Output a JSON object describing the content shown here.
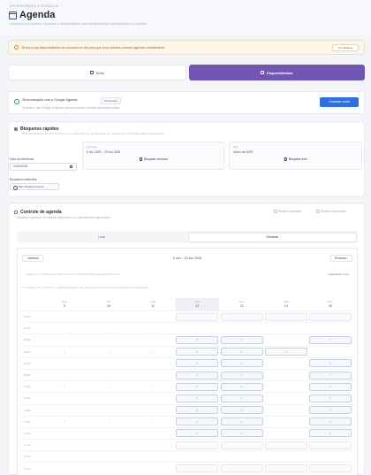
{
  "header": {
    "breadcrumb": "APPOINTMENTS & SCHEDULE",
    "title": "Agenda",
    "subtitle": "Gerencie seus horários, bloqueios e disponibilidade para atendimentos e agendamentos de clientes."
  },
  "alert": {
    "text": "Tenha a sua disponibilidade de consulta em dia para que seus clientes possam agendar corretamente.",
    "button_label": "Ver detalhes"
  },
  "tabs": [
    {
      "label": "Slots",
      "active": false
    },
    {
      "label": "Disponibilidade",
      "active": true
    }
  ],
  "sync": {
    "title": "Sincronização com o Google Agenda",
    "pill": "Desativado",
    "subtitle": "Conecte o seu Google Calendar para sincronizar eventos automaticamente.",
    "button_label": "Conectar conta"
  },
  "blocks": {
    "title": "Bloqueios rápidos",
    "subtitle": "Bloqueie rapidamente uma semana ou um mês inteiro de atendimentos em sua agenda. Os horários ficam indisponíveis.",
    "date_label": "Data de referência",
    "date_value": "11/06/2025",
    "week_label": "Semana",
    "week_value": "9 Jun 2025 – 15 Jun 2025",
    "week_button": "Bloquear semana",
    "month_label": "Mês",
    "month_value": "Junho de 2025",
    "month_button": "Bloquear mês",
    "existing_label": "Bloqueios existentes",
    "existing_chip": "Sem bloqueios ativos"
  },
  "agenda": {
    "title": "Controle de agenda",
    "subtitle": "Visualize e gerencie os horários disponíveis e os atendimentos agendados.",
    "check1": "Mostrar ocupados",
    "check2": "Mostrar bloqueados",
    "view_tabs": [
      {
        "label": "Lista",
        "active": false
      },
      {
        "label": "Semana",
        "active": true
      }
    ],
    "nav_prev": "‹ Anterior",
    "nav_center": "9 Jun – 15 Jun 2025",
    "nav_next": "Próxima ›",
    "info1": "Clique em um horário para abrir ou fechar a disponibilidade para agendamentos.",
    "legend": "Legenda de cores",
    "info2": "Os horários com o símbolo ✓ estão disponíveis para agendamento online pelos seus clientes neste período.",
    "days": [
      {
        "dow": "Seg",
        "num": "9",
        "today": false
      },
      {
        "dow": "Ter",
        "num": "10",
        "today": false
      },
      {
        "dow": "Qua",
        "num": "11",
        "today": false
      },
      {
        "dow": "Qui",
        "num": "12",
        "today": true
      },
      {
        "dow": "Sex",
        "num": "13",
        "today": false
      },
      {
        "dow": "Sáb",
        "num": "14",
        "today": false
      },
      {
        "dow": "Dom",
        "num": "15",
        "today": false
      }
    ],
    "rows": [
      {
        "time": "07:00",
        "cells": [
          "",
          "",
          "",
          "empty",
          "empty",
          "empty",
          "empty"
        ]
      },
      {
        "time": "07:30",
        "cells": [
          "",
          "",
          "",
          "",
          "",
          "",
          ""
        ]
      },
      {
        "time": "08:00",
        "cells": [
          "✓",
          "✓",
          "✓",
          "✓",
          "✓",
          "",
          "✓"
        ]
      },
      {
        "time": "08:30",
        "cells": [
          "✓",
          "✓",
          "✓",
          "✓",
          "✓",
          "✓",
          ""
        ]
      },
      {
        "time": "09:00",
        "cells": [
          "",
          "",
          "",
          "✓",
          "✓",
          "",
          "✓"
        ]
      },
      {
        "time": "09:30",
        "cells": [
          "",
          "",
          "",
          "✓",
          "✓",
          "",
          "✓"
        ]
      },
      {
        "time": "10:00",
        "cells": [
          "✓",
          "✓",
          "✓",
          "✓",
          "✓",
          "",
          "✓"
        ]
      },
      {
        "time": "10:30",
        "cells": [
          "",
          "",
          "",
          "✓",
          "✓",
          "",
          "✓"
        ]
      },
      {
        "time": "11:00",
        "cells": [
          "",
          "",
          "",
          "✓",
          "✓",
          "",
          "✓"
        ]
      },
      {
        "time": "11:30",
        "cells": [
          "✓",
          "✓",
          "✓",
          "✓",
          "✓",
          "",
          "✓"
        ]
      },
      {
        "time": "12:00",
        "cells": [
          "",
          "",
          "",
          "✓",
          "✓",
          "",
          "✓"
        ]
      },
      {
        "time": "12:30",
        "cells": [
          "",
          "",
          "",
          "empty",
          "empty",
          "empty",
          "empty"
        ]
      },
      {
        "time": "13:00",
        "cells": [
          "",
          "",
          "",
          "",
          "",
          "",
          ""
        ]
      },
      {
        "time": "13:30",
        "cells": [
          "",
          "",
          "",
          "empty",
          "empty",
          "empty",
          "empty"
        ]
      }
    ]
  },
  "colors": {
    "accent": "#7256b4",
    "primary_button": "#2f6fe0",
    "alert_bg": "#fdf5e8"
  }
}
